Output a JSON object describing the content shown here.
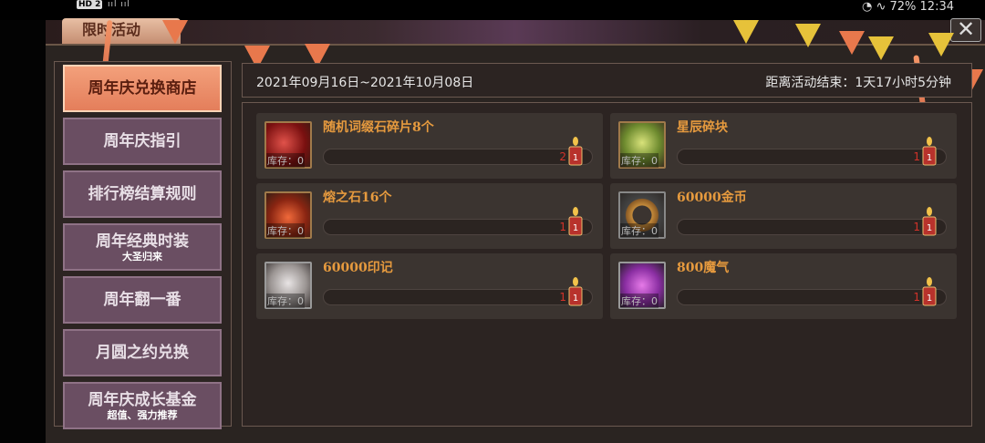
{
  "status_bar": {
    "hd_badge": "HD 2",
    "signal": "ııl  ııl",
    "right_text": "◔ ∿ 72%  12:34"
  },
  "window": {
    "tab_title": "限时活动",
    "close_symbol": "✕"
  },
  "menu": {
    "items": [
      {
        "label": "周年庆兑换商店",
        "sub": ""
      },
      {
        "label": "周年庆指引",
        "sub": ""
      },
      {
        "label": "排行榜结算规则",
        "sub": ""
      },
      {
        "label": "周年经典时装",
        "sub": "大圣归来"
      },
      {
        "label": "周年翻一番",
        "sub": ""
      },
      {
        "label": "月圆之约兑换",
        "sub": ""
      },
      {
        "label": "周年庆成长基金",
        "sub": "超值、强力推荐"
      }
    ],
    "active_index": 0
  },
  "header": {
    "date_range": "2021年09月16日~2021年10月08日",
    "countdown": "距离活动结束：1天17小时5分钟"
  },
  "shop": {
    "items": [
      {
        "name": "随机词缀石碎片8个",
        "stock": "库存：0",
        "count": "2",
        "icon": "red-gem-fragment-icon"
      },
      {
        "name": "星辰碎块",
        "stock": "库存：0",
        "count": "1",
        "icon": "green-crystal-icon"
      },
      {
        "name": "熔之石16个",
        "stock": "库存：0",
        "count": "1",
        "icon": "fire-stone-icon"
      },
      {
        "name": "60000金币",
        "stock": "库存：0",
        "count": "1",
        "icon": "gold-coin-icon"
      },
      {
        "name": "60000印记",
        "stock": "库存：0",
        "count": "1",
        "icon": "seal-shield-icon"
      },
      {
        "name": "800魔气",
        "stock": "库存：0",
        "count": "1",
        "icon": "purple-mana-icon"
      }
    ],
    "candle_label": "1"
  },
  "colors": {
    "accent_orange": "#e47e5b",
    "menu_purple": "#6a4e62",
    "item_name": "#e69a3e",
    "count_red": "#d2322a"
  }
}
